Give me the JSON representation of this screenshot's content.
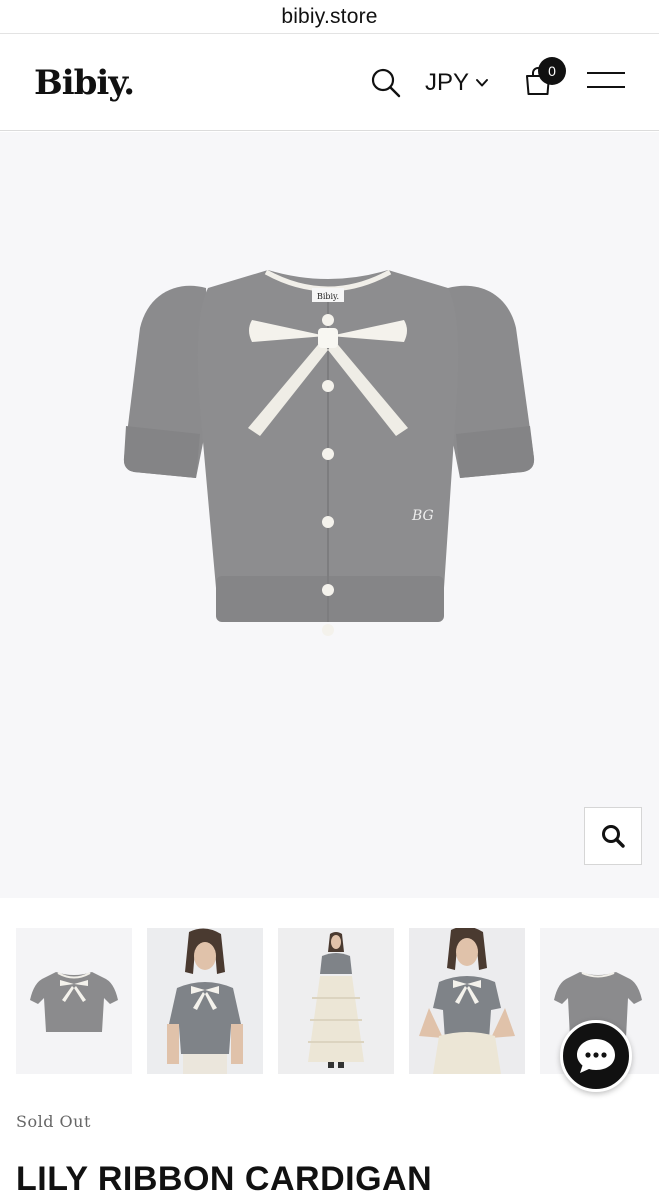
{
  "browser": {
    "url": "bibiy.store"
  },
  "header": {
    "logo_text": "Bibiy.",
    "currency": "JPY",
    "cart_count": "0",
    "icons": [
      "search-icon",
      "chevron-down-icon",
      "shopping-bag-icon",
      "hamburger-menu-icon"
    ]
  },
  "gallery": {
    "main_image": "grey short-sleeve cardigan with white ribbon bow",
    "garment_tag": "Bibiy.",
    "garment_monogram": "BG",
    "zoom_icon": "search-icon",
    "thumbnails": [
      "product-front",
      "model-front-closeup",
      "model-full-length",
      "model-front-hands-on-hips",
      "product-back"
    ]
  },
  "chat": {
    "icon": "chat-bubble-icon"
  },
  "product": {
    "status": "Sold Out",
    "title": "LILY RIBBON CARDIGAN"
  },
  "colors": {
    "garment_grey": "#8a8a8c",
    "ribbon_white": "#f4f2ec",
    "hero_bg": "#f7f7f9",
    "text": "#111111"
  }
}
